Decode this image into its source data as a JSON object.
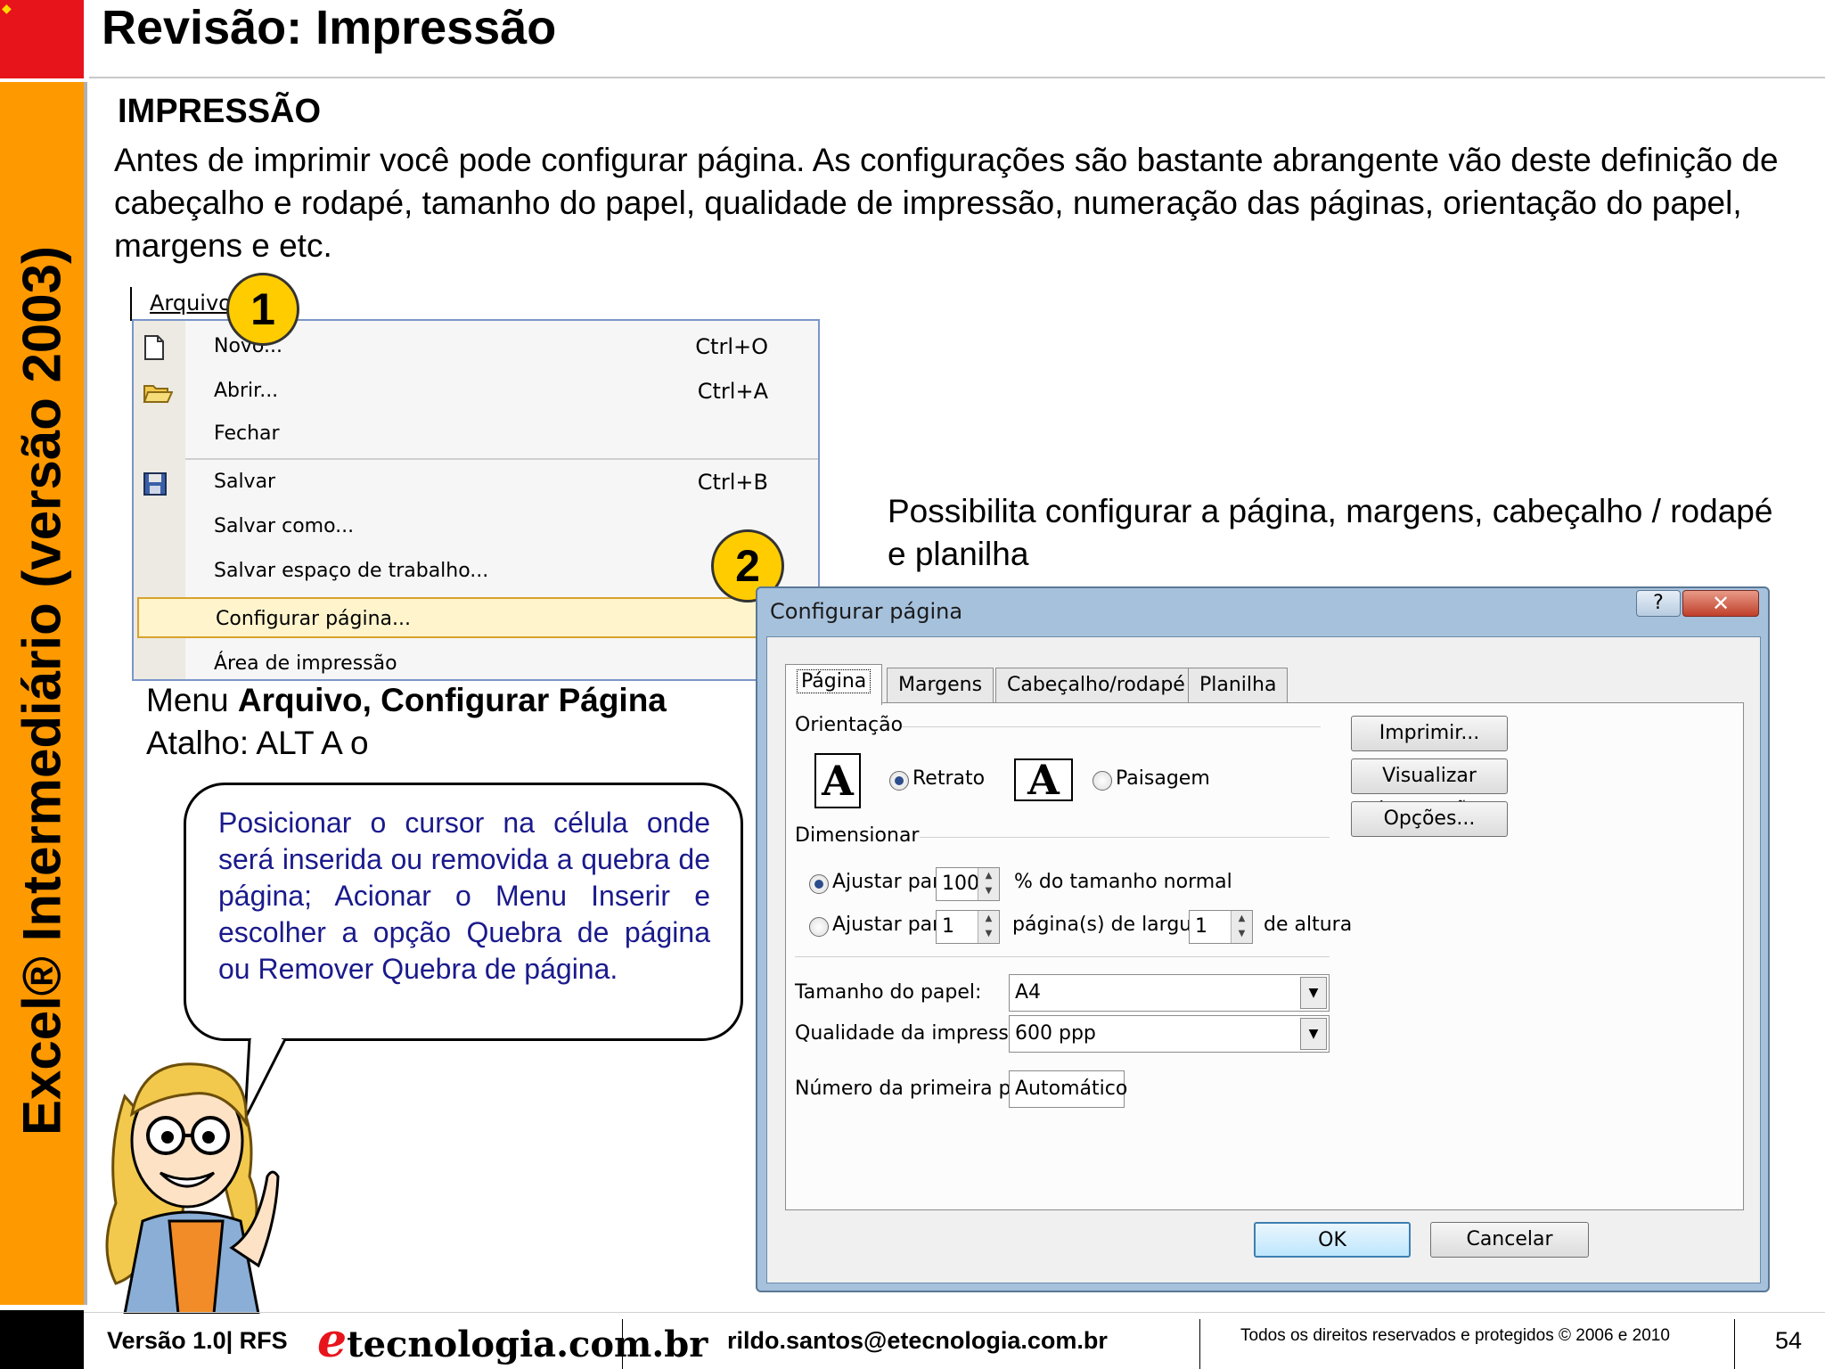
{
  "sidebar": {
    "vertical_title": "Excel® Intermediário (versão 2003)"
  },
  "header": {
    "title": "Revisão: Impressão"
  },
  "content": {
    "section_heading": "IMPRESSÃO",
    "intro": "Antes de imprimir você pode configurar  página. As configurações são bastante abrangente  vão deste definição de cabeçalho e rodapé, tamanho do papel, qualidade de impressão, numeração das páginas, orientação do papel, margens e etc.",
    "badge1": "1",
    "badge2": "2",
    "caption_prefix": "Menu ",
    "caption_bold": "Arquivo, Configurar Página",
    "shortcut": "Atalho: ALT A o",
    "bubble_text": "Posicionar o cursor na célula onde será inserida ou removida a quebra de página; Acionar o Menu Inserir e escolher a opção Quebra de página ou Remover Quebra de página.",
    "dialog_caption": "Possibilita configurar a página, margens, cabeçalho / rodapé e planilha"
  },
  "menu": {
    "title": "Arquivo",
    "items": [
      {
        "label": "Novo...",
        "shortcut": "Ctrl+O",
        "icon": "new-document-icon"
      },
      {
        "label": "Abrir...",
        "shortcut": "Ctrl+A",
        "icon": "open-folder-icon"
      },
      {
        "label": "Fechar",
        "shortcut": "",
        "icon": ""
      },
      {
        "label": "Salvar",
        "shortcut": "Ctrl+B",
        "icon": "save-disk-icon"
      },
      {
        "label": "Salvar como...",
        "shortcut": "",
        "icon": ""
      },
      {
        "label": "Salvar espaço de trabalho...",
        "shortcut": "",
        "icon": ""
      },
      {
        "label": "Configurar página...",
        "shortcut": "",
        "icon": "",
        "highlighted": true
      },
      {
        "label": "Área de impressão",
        "shortcut": "",
        "icon": ""
      }
    ]
  },
  "dialog": {
    "title": "Configurar página",
    "help": "?",
    "close": "✕",
    "tabs": [
      "Página",
      "Margens",
      "Cabeçalho/rodapé",
      "Planilha"
    ],
    "active_tab": "Página",
    "orientation_group": "Orientação",
    "portrait": "Retrato",
    "landscape": "Paisagem",
    "orientation_selected": "Retrato",
    "scaling_group": "Dimensionar",
    "fit_label": "Ajustar para:",
    "fit_value": "100",
    "fit_suffix": "% do tamanho normal",
    "fit2_label": "Ajustar para:",
    "fit2_wide": "1",
    "fit2_mid": "página(s) de largura por",
    "fit2_tall": "1",
    "fit2_suffix": "de altura",
    "paper_size_label": "Tamanho do papel:",
    "paper_size": "A4",
    "print_quality_label": "Qualidade da impressão:",
    "print_quality": "600 ppp",
    "first_page_label": "Número da primeira página:",
    "first_page": "Automático",
    "btn_print": "Imprimir...",
    "btn_preview": "Visualizar impressão",
    "btn_options": "Opções...",
    "btn_ok": "OK",
    "btn_cancel": "Cancelar"
  },
  "footer": {
    "version": "Versão 1.0| RFS",
    "logo_e": "e",
    "logo_rest": "tecnologia.com.br",
    "email": "rildo.santos@etecnologia.com.br",
    "rights": "Todos os direitos reservados e protegidos © 2006 e 2010",
    "page": "54"
  },
  "colors": {
    "sidebar_orange": "#ff9900",
    "corner_red": "#e8141b",
    "bubble_text": "#1a1a8c",
    "badge_yellow": "#ffcc00"
  }
}
